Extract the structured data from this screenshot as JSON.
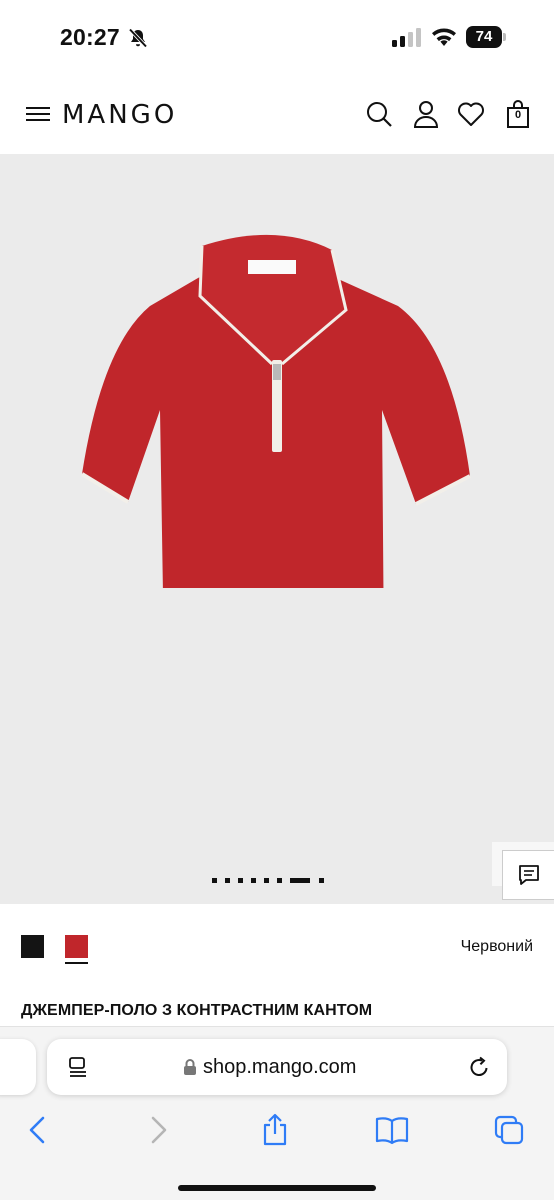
{
  "status_bar": {
    "time": "20:27",
    "battery_level": "74"
  },
  "header": {
    "logo": "MANGO",
    "bag_count": "0",
    "icons": [
      "menu-icon",
      "search-icon",
      "account-icon",
      "heart-icon",
      "shopping-bag-icon"
    ]
  },
  "gallery": {
    "image_count": 8,
    "active_index": 6,
    "product_color_hex": "#c0262b"
  },
  "colors": {
    "swatches": [
      {
        "name": "black",
        "hex": "#141414"
      },
      {
        "name": "red",
        "hex": "#c0262b"
      }
    ],
    "selected_label": "Червоний"
  },
  "product": {
    "title": "ДЖЕМПЕР-ПОЛО З КОНТРАСТНИМ КАНТОМ"
  },
  "browser": {
    "url": "shop.mango.com",
    "toolbar_icons": [
      "back-icon",
      "forward-icon",
      "share-icon",
      "bookmarks-icon",
      "tabs-icon"
    ]
  }
}
